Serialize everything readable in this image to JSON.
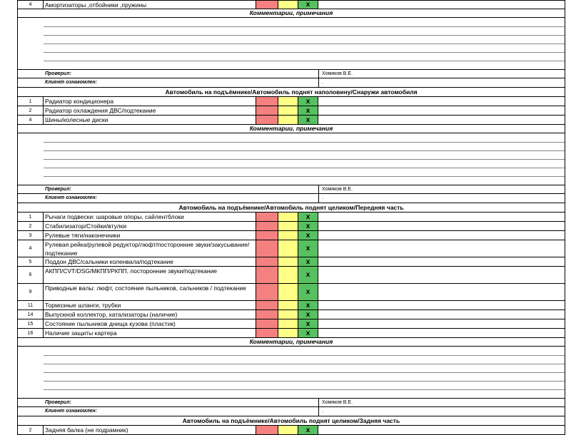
{
  "blocks": [
    {
      "items": [
        {
          "num": "4",
          "name": "Амортизаторы ,отбойники ,пружины",
          "mark": "x"
        }
      ],
      "comment_title": "Комментарии, примечания",
      "checked_label": "Проверил:",
      "checked_value": "Хомяков В.Е.",
      "client_label": "Клиент ознакомлен:",
      "client_value": "."
    },
    {
      "title": "Автомобиль на подъёмнике/Автомобиль поднят наполовину/Снаружи автомобиля",
      "items": [
        {
          "num": "1",
          "name": "Радиатор кондиционера",
          "mark": "x"
        },
        {
          "num": "2",
          "name": "Радиатор охлаждения ДВС/подтекание",
          "mark": "x"
        },
        {
          "num": "4",
          "name": "Шины/колесные диски",
          "mark": "x"
        }
      ],
      "comment_title": "Комментарии, примечания",
      "checked_label": "Проверил:",
      "checked_value": "Хомяков В.Е.",
      "client_label": "Клиент ознакомлен:",
      "client_value": "."
    },
    {
      "title": "Автомобиль на подъёмнике/Автомобиль поднят целиком/Передняя часть",
      "items": [
        {
          "num": "1",
          "name": "Рычаги подвески: шаровые опоры, сайлентблоки",
          "mark": "x"
        },
        {
          "num": "2",
          "name": "Стабилизатор/Стойки/втулки",
          "mark": "x"
        },
        {
          "num": "3",
          "name": "Рулевые тяги/наконечники",
          "mark": "x"
        },
        {
          "num": "4",
          "name": "Рулевая рейка/рулевой редуктор/люфт/посторонние звуки/закусывание/подтекание",
          "mark": "x"
        },
        {
          "num": "5",
          "name": "Поддон ДВС/сальники коленвала/подтекание",
          "mark": "x"
        },
        {
          "num": "6",
          "name": "АКПП/CVT/DSG/МКПП/РКПП, посторонние звуки/подтекание",
          "mark": "x"
        },
        {
          "num": "9",
          "name": "Приводные валы: люфт, состояние пыльников, сальников / подтекание",
          "mark": "x"
        },
        {
          "num": "11",
          "name": "Тормозные шланги, трубки",
          "mark": "x"
        },
        {
          "num": "14",
          "name": "Выпускной коллектор, катализаторы (наличие)",
          "mark": "x"
        },
        {
          "num": "15",
          "name": "Состояние пыльников днища кузова (пластик)",
          "mark": "x"
        },
        {
          "num": "16",
          "name": "Наличие защиты картера",
          "mark": "x"
        }
      ],
      "comment_title": "Комментарии, примечания",
      "checked_label": "Проверил:",
      "checked_value": "Хомяков В.Е.",
      "client_label": "Клиент ознакомлен:",
      "client_value": "."
    },
    {
      "title": "Автомобиль на подъёмнике/Автомобиль поднят целиком/Задняя часть",
      "items": [
        {
          "num": "2",
          "name": "Задняя балка (не подрамник)",
          "mark": "x"
        }
      ]
    }
  ],
  "colors": {
    "red": "#f48080",
    "yellow": "#ffff86",
    "green": "#58c060"
  }
}
